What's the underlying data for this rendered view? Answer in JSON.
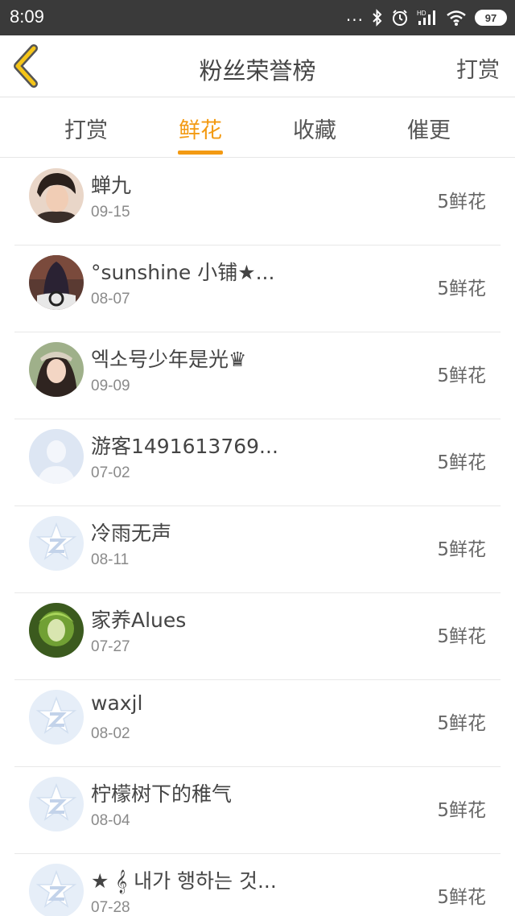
{
  "status_bar": {
    "time": "8:09",
    "dots": "...",
    "battery": "97"
  },
  "nav": {
    "back_icon": "chevron-left-icon",
    "title": "粉丝荣誉榜",
    "action": "打赏"
  },
  "tabs": [
    {
      "label": "打赏",
      "active": false
    },
    {
      "label": "鲜花",
      "active": true
    },
    {
      "label": "收藏",
      "active": false
    },
    {
      "label": "催更",
      "active": false
    }
  ],
  "colors": {
    "accent": "#f39a12",
    "statusbar": "#3a3a3a",
    "back_icon_fill": "#f5c518"
  },
  "fans": [
    {
      "name": "蝉九",
      "date": "09-15",
      "amount": "5鲜花",
      "avatar": "photo-boy"
    },
    {
      "name": "°sunshine 小铺★...",
      "date": "08-07",
      "amount": "5鲜花",
      "avatar": "photo-dark"
    },
    {
      "name": "엑소号少年是光♛",
      "date": "09-09",
      "amount": "5鲜花",
      "avatar": "photo-girl"
    },
    {
      "name": "游客1491613769...",
      "date": "07-02",
      "amount": "5鲜花",
      "avatar": "default-person"
    },
    {
      "name": "冷雨无声",
      "date": "08-11",
      "amount": "5鲜花",
      "avatar": "default-star"
    },
    {
      "name": "家养Alues",
      "date": "07-27",
      "amount": "5鲜花",
      "avatar": "photo-green"
    },
    {
      "name": "waxjl",
      "date": "08-02",
      "amount": "5鲜花",
      "avatar": "default-star"
    },
    {
      "name": "柠檬树下的稚气",
      "date": "08-04",
      "amount": "5鲜花",
      "avatar": "default-star"
    },
    {
      "name": "★ 𝄞 내가 행하는 것...",
      "date": "07-28",
      "amount": "5鲜花",
      "avatar": "default-star"
    }
  ]
}
